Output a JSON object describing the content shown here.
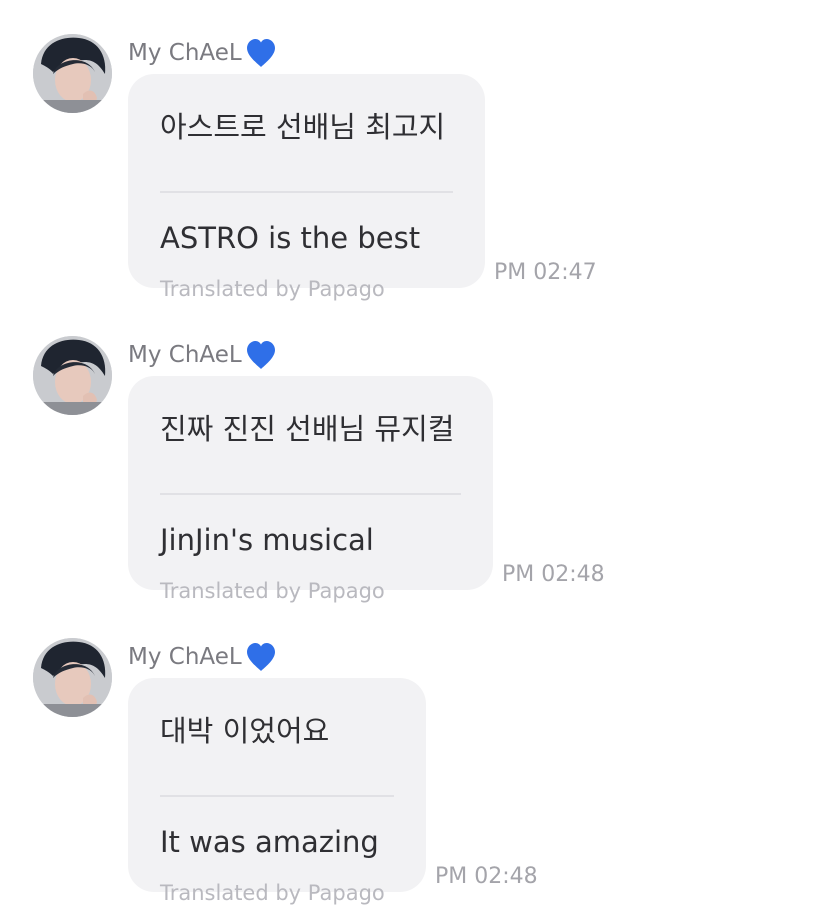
{
  "messages": [
    {
      "sender": "My ChAeL",
      "sender_icon": "blue-heart-icon",
      "original": "아스트로 선배님 최고지",
      "translated": "ASTRO is the best",
      "credit": "Translated by Papago",
      "time": "PM 02:47"
    },
    {
      "sender": "My ChAeL",
      "sender_icon": "blue-heart-icon",
      "original": "진짜 진진 선배님 뮤지컬",
      "translated": "JinJin's musical",
      "credit": "Translated by Papago",
      "time": "PM 02:48"
    },
    {
      "sender": "My ChAeL",
      "sender_icon": "blue-heart-icon",
      "original": "대박 이었어요",
      "translated": "It was amazing",
      "credit": "Translated by Papago",
      "time": "PM 02:48"
    }
  ],
  "colors": {
    "heart": "#2f6fe8",
    "bubble": "#f2f2f4",
    "text": "#2f2f33",
    "muted": "#a4a4aa"
  }
}
